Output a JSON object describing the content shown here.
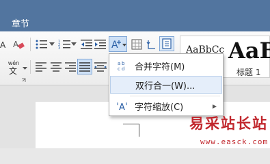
{
  "title_bar": {
    "tab_label": "章节",
    "color": "#52759f"
  },
  "ribbon": {
    "font_color_glyph": "A",
    "phonetic_glyph": "wén",
    "style_gallery": {
      "sample_small": "AaBbCc",
      "sample_large": "AaB",
      "heading_name": "标题 1"
    }
  },
  "menu": {
    "items": [
      {
        "label": "合并字符(M)",
        "icon": "combine-characters-icon",
        "icon_glyph": "ab"
      },
      {
        "label": "双行合一(W)...",
        "icon": "",
        "highlighted": true
      },
      {
        "label": "字符缩放(C)",
        "icon": "char-scale-icon",
        "icon_glyph": "A",
        "has_submenu": true
      }
    ]
  },
  "watermark": {
    "line1": "易采站长站",
    "line2": "www.easck.com",
    "color": "#c1272d"
  }
}
